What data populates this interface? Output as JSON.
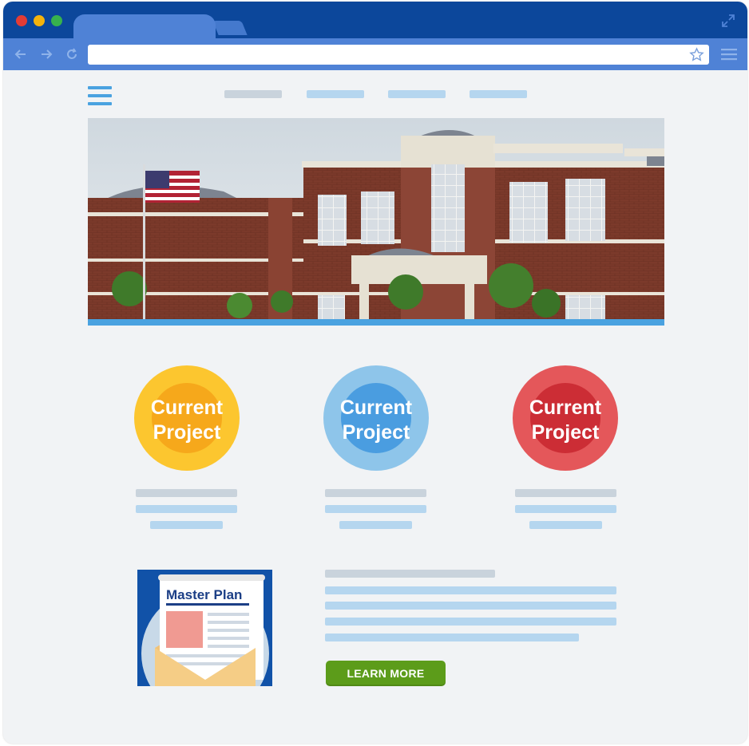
{
  "browser": {
    "traffic_lights": [
      "#e43c35",
      "#f5b30c",
      "#37b24d"
    ],
    "chrome_color": "#0c479b",
    "toolbar_color": "#4f82d6",
    "url": ""
  },
  "site": {
    "accent": "#4aa2e0",
    "projects": [
      {
        "label_line1": "Current",
        "label_line2": "Project",
        "outer": "#fcc62f",
        "inner": "#f6a81b"
      },
      {
        "label_line1": "Current",
        "label_line2": "Project",
        "outer": "#8ec5ea",
        "inner": "#4a9de0"
      },
      {
        "label_line1": "Current",
        "label_line2": "Project",
        "outer": "#e4575a",
        "inner": "#cc2d35"
      }
    ],
    "master_plan": {
      "title": "Master Plan"
    },
    "cta": {
      "label": "LEARN MORE",
      "color": "#5c9c1a"
    }
  }
}
